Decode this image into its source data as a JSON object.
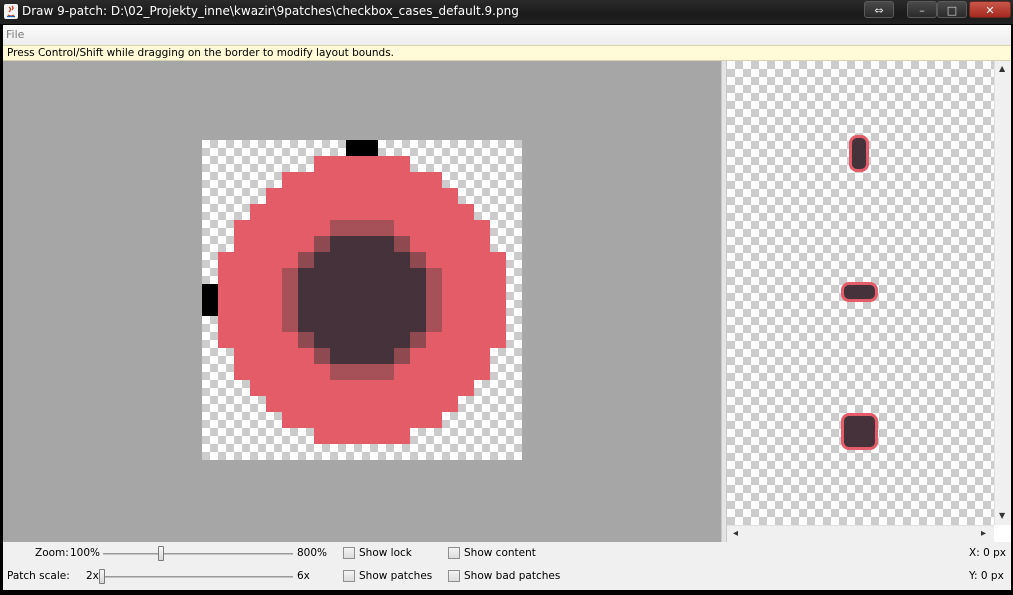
{
  "window": {
    "title": "Draw 9-patch: D:\\02_Projekty_inne\\kwazir\\9patches\\checkbox_cases_default.9.png",
    "buttons": {
      "switch": "⇔",
      "minimize": "–",
      "maximize": "□",
      "close": "✕"
    }
  },
  "menu": {
    "file": "File"
  },
  "hint": "Press Control/Shift while dragging on the border to modify layout bounds.",
  "colors": {
    "editor_bg": "#a6a6a6",
    "fill_red": "#e35c68",
    "center_dark": "#45323a",
    "ring_mid": "#8e4951",
    "ring_light": "#a65058",
    "patch_marker": "#000000"
  },
  "controls": {
    "zoom": {
      "label": "Zoom:",
      "min": "100%",
      "max": "800%",
      "value_fraction": 0.3
    },
    "patch_scale": {
      "label": "Patch scale:",
      "min": "2x",
      "max": "6x",
      "value_fraction": 0.0
    },
    "checkboxes": {
      "show_lock": {
        "label": "Show lock",
        "checked": false
      },
      "show_patches": {
        "label": "Show patches",
        "checked": false
      },
      "show_content": {
        "label": "Show content",
        "checked": false
      },
      "show_bad_patches": {
        "label": "Show bad patches",
        "checked": false
      }
    },
    "coords": {
      "x": "X: 0 px",
      "y": "Y: 0 px"
    }
  },
  "icons": {
    "app": "java-icon",
    "scroll_up": "▲",
    "scroll_down": "▼",
    "scroll_left": "◂",
    "scroll_right": "▸"
  }
}
